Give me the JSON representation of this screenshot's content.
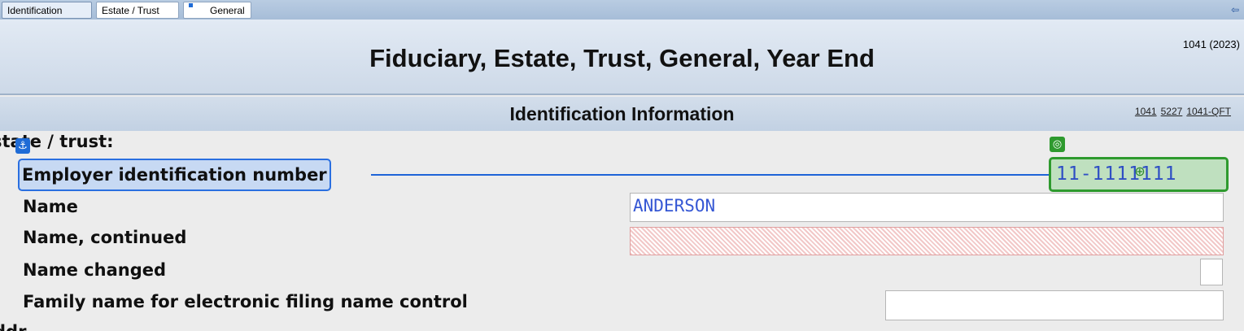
{
  "tabs": [
    {
      "label": "Identification",
      "active": true
    },
    {
      "label": "Estate / Trust",
      "active": false
    },
    {
      "label": "General",
      "active": false
    }
  ],
  "header": {
    "form_id": "1041 (2023)",
    "title": "Fiduciary, Estate, Trust, General, Year End"
  },
  "section": {
    "title": "Identification Information",
    "links": [
      "1041",
      "5227",
      "1041-QFT"
    ]
  },
  "rows": {
    "group_label": "state / trust:",
    "ein_label": "Employer identification number",
    "ein_value": "11-1111111",
    "name_label": "Name",
    "name_value": "ANDERSON",
    "name_cont_label": "Name, continued",
    "name_cont_value": "",
    "name_changed_label": "Name changed",
    "family_label": "Family name for electronic filing name control",
    "family_value": "",
    "next_group_label": "ddr"
  },
  "colors": {
    "accent_blue": "#1e64d8",
    "active_green": "#2e9a2e",
    "value_text": "#3557d4",
    "error_fill": "#f2c8c8"
  },
  "icons": {
    "anchor": "anchor-icon",
    "target": "target-icon",
    "cursor": "cursor-crosshair-icon",
    "corner": "exit-icon"
  }
}
